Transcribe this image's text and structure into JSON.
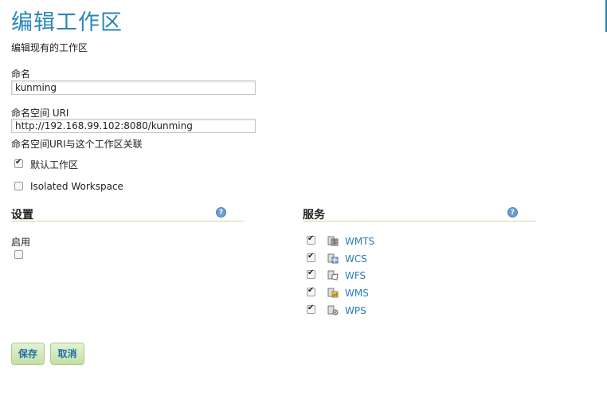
{
  "page": {
    "title": "编辑工作区",
    "subtitle": "编辑现有的工作区"
  },
  "form": {
    "name_label": "命名",
    "name_value": "kunming",
    "uri_label": "命名空间 URI",
    "uri_value": "http://192.168.99.102:8080/kunming",
    "uri_help": "命名空间URI与这个工作区关联",
    "default_workspace_label": "默认工作区",
    "default_workspace_checked": true,
    "isolated_label": "Isolated Workspace",
    "isolated_checked": false
  },
  "settings": {
    "title": "设置",
    "enabled_label": "启用",
    "enabled_checked": false
  },
  "services": {
    "title": "服务",
    "items": [
      {
        "label": "WMTS",
        "checked": true,
        "icon": "wmts-server-icon"
      },
      {
        "label": "WCS",
        "checked": true,
        "icon": "wcs-server-icon"
      },
      {
        "label": "WFS",
        "checked": true,
        "icon": "wfs-server-icon"
      },
      {
        "label": "WMS",
        "checked": true,
        "icon": "wms-server-icon"
      },
      {
        "label": "WPS",
        "checked": true,
        "icon": "wps-server-icon"
      }
    ]
  },
  "actions": {
    "save_label": "保存",
    "cancel_label": "取消"
  },
  "colors": {
    "title": "#2b86b7",
    "link": "#2b7cb3",
    "button_bg": "#c4e0a6",
    "section_line": "#c8dca0"
  }
}
